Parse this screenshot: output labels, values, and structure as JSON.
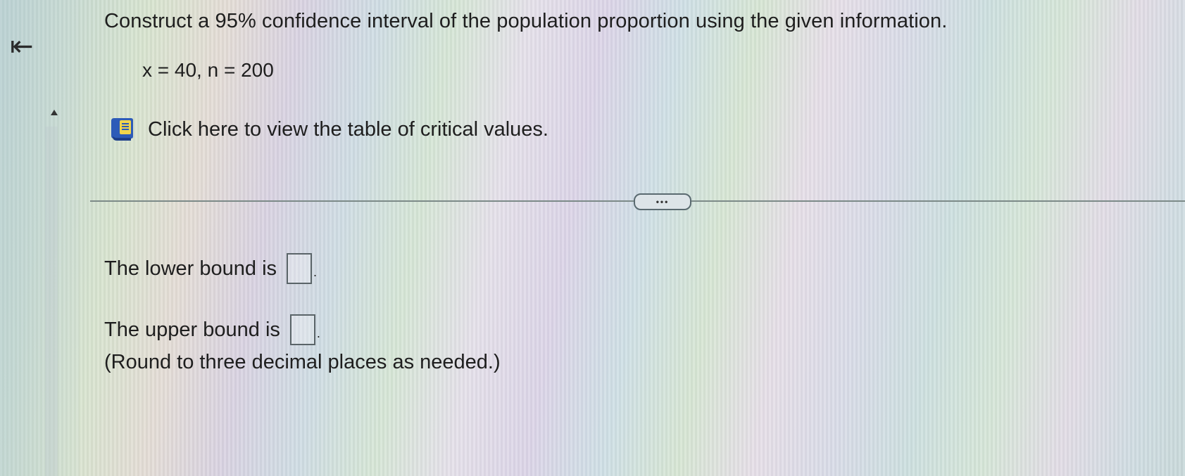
{
  "nav": {
    "back_glyph": "⇤"
  },
  "question": {
    "text": "Construct a 95% confidence interval of the population proportion using the given information.",
    "given": "x = 40, n = 200"
  },
  "table_link": {
    "icon": "book-icon",
    "label": "Click here to view the table of critical values."
  },
  "divider": {
    "more_label": "•••"
  },
  "answers": {
    "lower_label": "The lower bound is",
    "lower_value": "",
    "upper_label": "The upper bound is",
    "upper_value": "",
    "period": "."
  },
  "note": "(Round to three decimal places as needed.)",
  "colors": {
    "accent_blue": "#2d5bb8",
    "icon_yellow": "#f2d64b",
    "text": "#1e1e1e"
  }
}
